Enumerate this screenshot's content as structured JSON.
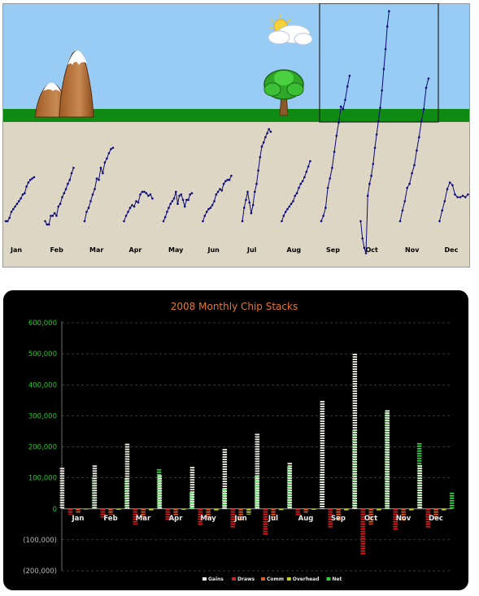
{
  "chart_data": [
    {
      "type": "line",
      "months": [
        "Jan",
        "Feb",
        "Mar",
        "Apr",
        "May",
        "Jun",
        "Jul",
        "Aug",
        "Sep",
        "Oct",
        "Nov",
        "Dec"
      ],
      "series": [
        {
          "month": "Jan",
          "values": [
            0,
            0,
            5,
            14,
            18,
            22,
            26,
            30,
            34,
            40,
            42,
            52,
            58,
            62,
            64,
            66
          ]
        },
        {
          "month": "Feb",
          "values": [
            0,
            -5,
            -5,
            8,
            8,
            12,
            8,
            22,
            26,
            36,
            42,
            48,
            56,
            62,
            72,
            80
          ]
        },
        {
          "month": "Mar",
          "values": [
            0,
            14,
            20,
            30,
            40,
            48,
            64,
            62,
            80,
            72,
            88,
            94,
            102,
            108,
            110
          ]
        },
        {
          "month": "Apr",
          "values": [
            0,
            8,
            14,
            20,
            24,
            22,
            30,
            28,
            40,
            44,
            44,
            42,
            38,
            40,
            34
          ]
        },
        {
          "month": "May",
          "values": [
            0,
            6,
            14,
            20,
            26,
            30,
            34,
            44,
            26,
            38,
            40,
            32,
            22,
            32,
            32,
            40,
            42
          ]
        },
        {
          "month": "Jun",
          "values": [
            0,
            8,
            14,
            18,
            20,
            24,
            30,
            40,
            44,
            48,
            46,
            56,
            60,
            62,
            62,
            68
          ]
        },
        {
          "month": "Jul",
          "values": [
            0,
            20,
            32,
            44,
            28,
            12,
            24,
            44,
            56,
            76,
            96,
            112,
            118,
            126,
            132,
            138,
            134
          ]
        },
        {
          "month": "Aug",
          "values": [
            0,
            8,
            14,
            18,
            22,
            26,
            30,
            38,
            42,
            50,
            56,
            60,
            66,
            74,
            82,
            90
          ]
        },
        {
          "month": "Sep",
          "values": [
            0,
            8,
            20,
            50,
            64,
            80,
            104,
            128,
            148,
            172,
            168,
            182,
            202,
            218
          ]
        },
        {
          "month": "Oct",
          "values": [
            0,
            -26,
            -40,
            -48,
            38,
            56,
            68,
            86,
            110,
            130,
            150,
            170,
            196,
            228,
            258,
            292,
            315
          ]
        },
        {
          "month": "Nov",
          "values": [
            0,
            16,
            30,
            50,
            56,
            72,
            84,
            106,
            126,
            150,
            168,
            200,
            214
          ]
        },
        {
          "month": "Dec",
          "values": [
            0,
            16,
            30,
            48,
            58,
            54,
            40,
            36,
            36,
            38,
            36,
            40
          ]
        }
      ]
    },
    {
      "type": "bar",
      "title": "2008 Monthly Chip Stacks",
      "categories": [
        "Jan",
        "Feb",
        "Mar",
        "Apr",
        "May",
        "Jun",
        "Jul",
        "Aug",
        "Sep",
        "Oct",
        "Nov",
        "Dec"
      ],
      "ylim": [
        -200000,
        600000
      ],
      "yticks": [
        {
          "value": 600000,
          "label": "600,000"
        },
        {
          "value": 500000,
          "label": "500,000"
        },
        {
          "value": 400000,
          "label": "400,000"
        },
        {
          "value": 300000,
          "label": "300,000"
        },
        {
          "value": 200000,
          "label": "200,000"
        },
        {
          "value": 100000,
          "label": "100,000"
        },
        {
          "value": 0,
          "label": "0"
        },
        {
          "value": -100000,
          "label": "(100,000)"
        },
        {
          "value": -200000,
          "label": "(200,000)"
        }
      ],
      "grid": true,
      "legend_position": "bottom-right",
      "series": [
        {
          "name": "Gains",
          "color": "#f2f2e8",
          "values": [
            132000,
            140000,
            210000,
            108000,
            135000,
            193000,
            242000,
            148000,
            348000,
            500000,
            318000,
            140000
          ]
        },
        {
          "name": "Draws",
          "color": "#d42020",
          "values": [
            -18000,
            -28000,
            -50000,
            -35000,
            -52000,
            -62000,
            -85000,
            -20000,
            -60000,
            -150000,
            -68000,
            -60000
          ]
        },
        {
          "name": "Comm",
          "color": "#e05a1a",
          "values": [
            -12000,
            -18000,
            -32000,
            -22000,
            -32000,
            -38000,
            -30000,
            -12000,
            -38000,
            -50000,
            -40000,
            -30000
          ]
        },
        {
          "name": "Overhead",
          "color": "#c8d020",
          "values": [
            -2000,
            -3000,
            -5000,
            -3000,
            -8000,
            -18000,
            -4000,
            -3000,
            -5000,
            -8000,
            -5000,
            -7000
          ]
        },
        {
          "name": "Net",
          "color": "#2fcf3a",
          "values": [
            100000,
            98000,
            128000,
            52000,
            62000,
            105000,
            135000,
            112000,
            250000,
            312000,
            212000,
            52000
          ]
        }
      ]
    }
  ],
  "colors": {
    "sky": "#99ccf5",
    "grass": "#0f8a12",
    "ground": "#ded7c5",
    "line": "#0b0b7a",
    "panel_bg": "#000000",
    "axis_text": "#29c42a",
    "title": "#e07a2e"
  },
  "icons": [
    "mountain-icon",
    "sun-cloud-icon",
    "tree-icon"
  ]
}
